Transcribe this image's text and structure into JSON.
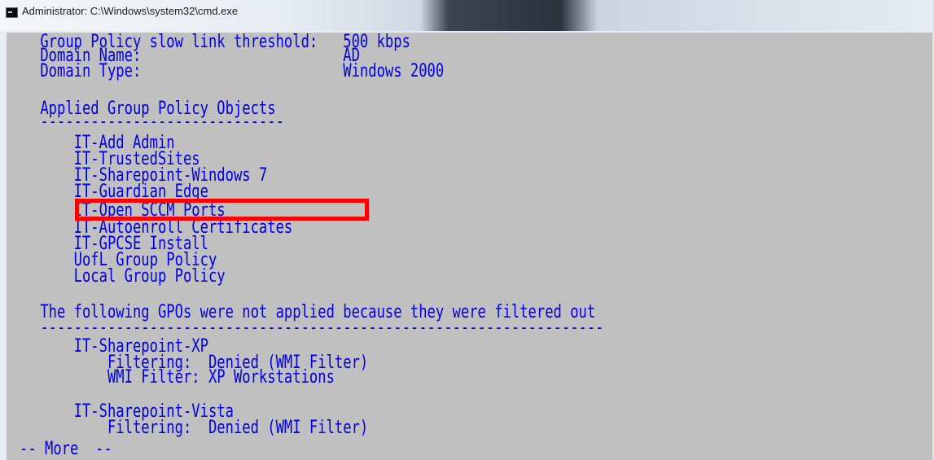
{
  "window": {
    "title": "Administrator: C:\\Windows\\system32\\cmd.exe"
  },
  "console": {
    "lines": [
      "    Group Policy slow link threshold:   500 kbps",
      "    Domain Name:                        AD",
      "    Domain Type:                        Windows 2000",
      "",
      "    Applied Group Policy Objects",
      "    -----------------------------",
      "        IT-Add Admin",
      "        IT-TrustedSites",
      "        IT-Sharepoint-Windows 7",
      "        IT-Guardian Edge",
      "        IT-Open SCCM Ports",
      "        IT-Autoenroll Certificates",
      "        IT-GPCSE Install",
      "        UofL Group Policy",
      "        Local Group Policy",
      "",
      "    The following GPOs were not applied because they were filtered out",
      "    -------------------------------------------------------------------",
      "        IT-Sharepoint-XP",
      "            Filtering:  Denied (WMI Filter)",
      "            WMI Filter: XP Workstations",
      "",
      "        IT-Sharepoint-Vista",
      "            Filtering:  Denied (WMI Filter)"
    ],
    "pager": "-- More  --",
    "highlighted_entry": "IT-Open SCCM Ports"
  },
  "colors": {
    "console_background": "#c0c0c0",
    "console_text": "#0000e0",
    "highlight_border": "#ff0000"
  }
}
